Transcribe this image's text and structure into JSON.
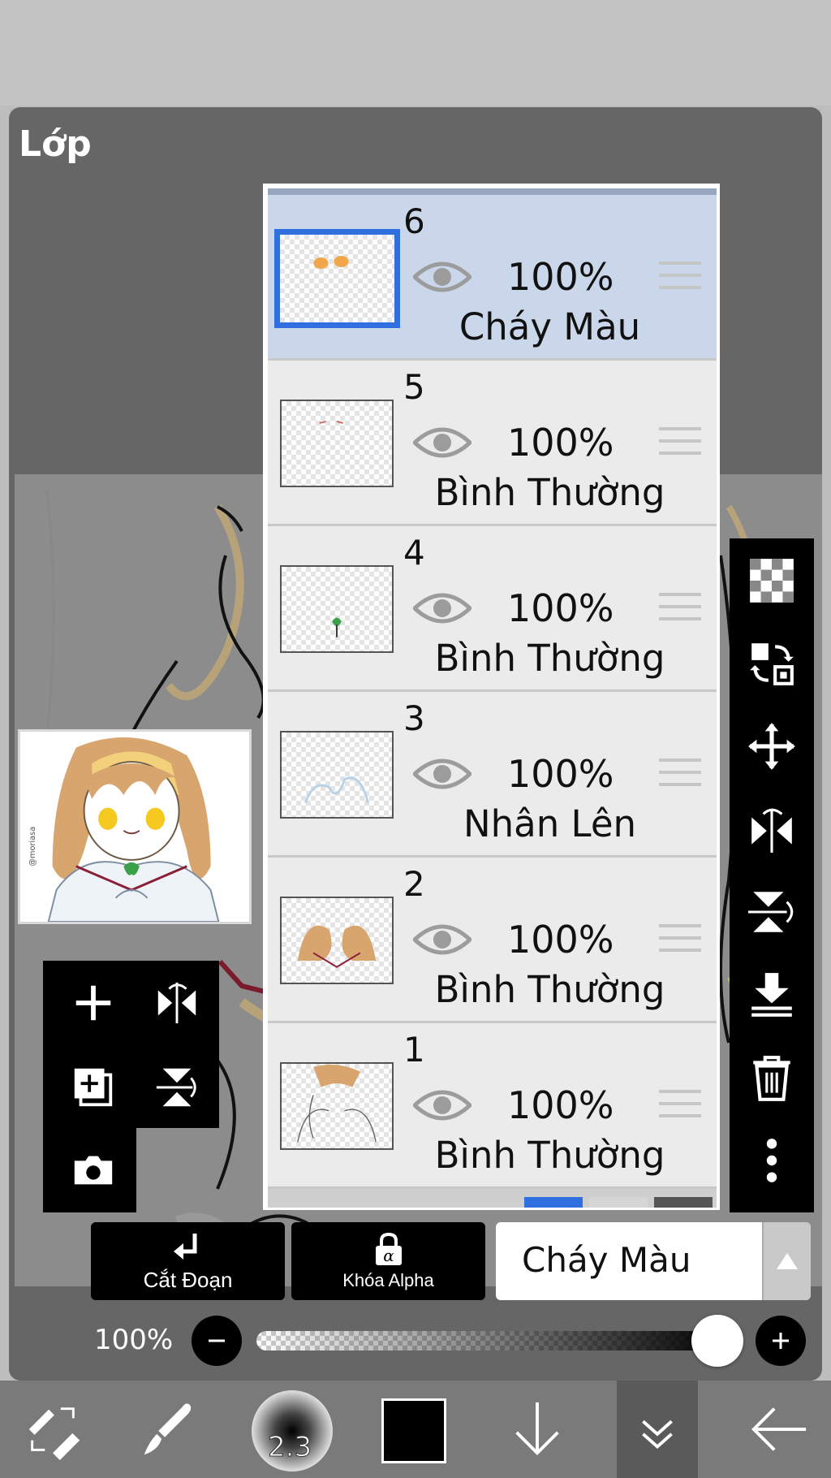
{
  "panel": {
    "title": "Lớp"
  },
  "layers": [
    {
      "number": "6",
      "opacity": "100%",
      "blend": "Cháy Màu",
      "selected": true
    },
    {
      "number": "5",
      "opacity": "100%",
      "blend": "Bình Thường",
      "selected": false
    },
    {
      "number": "4",
      "opacity": "100%",
      "blend": "Bình Thường",
      "selected": false
    },
    {
      "number": "3",
      "opacity": "100%",
      "blend": "Nhân Lên",
      "selected": false
    },
    {
      "number": "2",
      "opacity": "100%",
      "blend": "Bình Thường",
      "selected": false
    },
    {
      "number": "1",
      "opacity": "100%",
      "blend": "Bình Thường",
      "selected": false
    }
  ],
  "actions": {
    "cut_label": "Cắt Đoạn",
    "alpha_lock_label": "Khóa Alpha",
    "blend_mode": "Cháy Màu"
  },
  "opacity": {
    "label": "100%",
    "value": 1.0
  },
  "toolbar": {
    "brush_size": "2.3",
    "current_color": "#000000"
  },
  "thumbnail": {
    "signature": "@moriasa"
  },
  "icons": {
    "left_tools": [
      "plus-icon",
      "flip-horizontal-icon",
      "duplicate-layer-icon",
      "flip-vertical-icon",
      "camera-icon"
    ],
    "right_tools": [
      "transparency-icon",
      "swap-icon",
      "move-icon",
      "flip-horizontal-icon",
      "flip-vertical-icon",
      "merge-down-icon",
      "trash-icon",
      "more-vertical-icon"
    ],
    "bottom_bar": [
      "tool-switch-icon",
      "brush-icon",
      "brush-size-icon",
      "color-swatch-icon",
      "arrow-down-icon",
      "chevron-double-down-icon",
      "arrow-left-icon"
    ]
  }
}
